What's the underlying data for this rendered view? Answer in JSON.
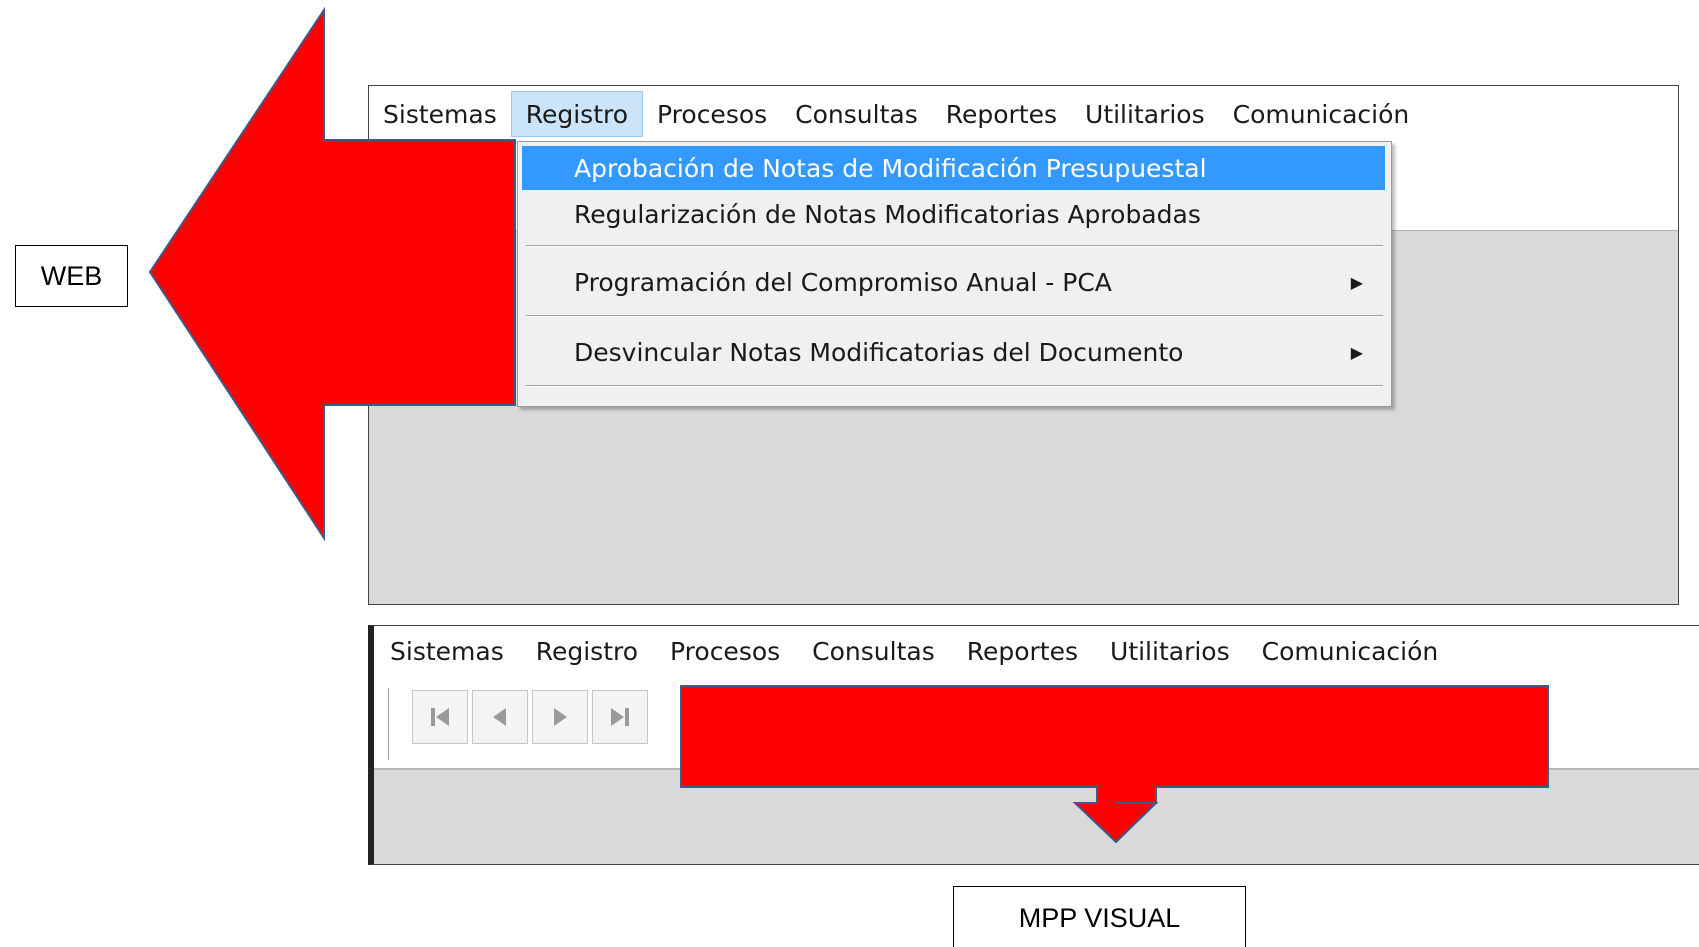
{
  "labels": {
    "web": "WEB",
    "mpp": "MPP VISUAL"
  },
  "top_window": {
    "menu": [
      "Sistemas",
      "Registro",
      "Procesos",
      "Consultas",
      "Reportes",
      "Utilitarios",
      "Comunicación"
    ],
    "active_menu": "Registro",
    "dropdown": {
      "items": [
        "Aprobación de Notas de Modificación Presupuestal",
        "Regularización de Notas Modificatorias Aprobadas",
        "Programación del Compromiso Anual - PCA",
        "Desvincular Notas Modificatorias del Documento"
      ],
      "highlighted_item": "Aprobación de Notas de Modificación Presupuestal",
      "submenu_arrow": "▶"
    }
  },
  "bottom_window": {
    "menu": [
      "Sistemas",
      "Registro",
      "Procesos",
      "Consultas",
      "Reportes",
      "Utilitarios",
      "Comunicación"
    ],
    "nav_buttons": [
      "first-record-icon",
      "previous-record-icon",
      "next-record-icon",
      "last-record-icon"
    ]
  },
  "colors": {
    "arrow_fill": "#ff0000",
    "arrow_stroke": "#3a5a8a",
    "highlight": "#3399ff",
    "active_menu_bg": "#cce4f7"
  }
}
